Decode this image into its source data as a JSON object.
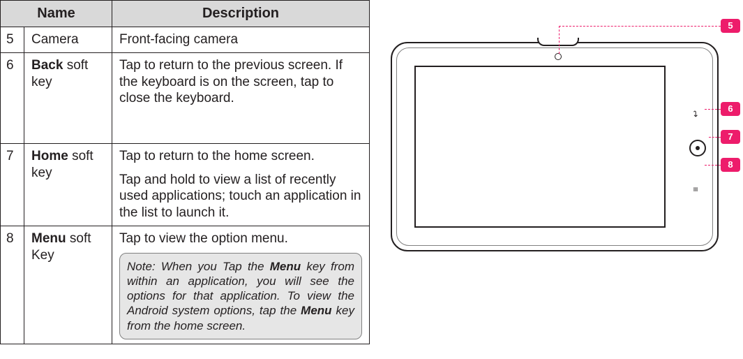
{
  "table": {
    "headers": {
      "name": "Name",
      "description": "Description"
    },
    "rows": [
      {
        "num": "5",
        "name_bold": "",
        "name_rest": "Camera",
        "desc": [
          "Front-facing camera"
        ],
        "note": null
      },
      {
        "num": "6",
        "name_bold": "Back",
        "name_rest": " soft key",
        "desc": [
          "Tap to return to the previous screen. If the keyboard is on the screen, tap to close the keyboard."
        ],
        "note": null
      },
      {
        "num": "7",
        "name_bold": "Home",
        "name_rest": " soft key",
        "desc": [
          "Tap to return to the home screen.",
          "Tap and hold to view a list of recently used applications; touch an application in the list to launch it."
        ],
        "note": null
      },
      {
        "num": "8",
        "name_bold": "Menu",
        "name_rest": "  soft Key",
        "desc": [
          "Tap to view the option menu."
        ],
        "note": {
          "pre": "Note: When you Tap the ",
          "b1": "Menu",
          "mid": " key from within an application, you will see the options for that application. To view the Android system options, tap the ",
          "b2": "Menu",
          "post": " key from the home screen."
        }
      }
    ]
  },
  "callouts": {
    "c5": "5",
    "c6": "6",
    "c7": "7",
    "c8": "8"
  },
  "icons": {
    "back": "↩",
    "menu": "≡"
  }
}
